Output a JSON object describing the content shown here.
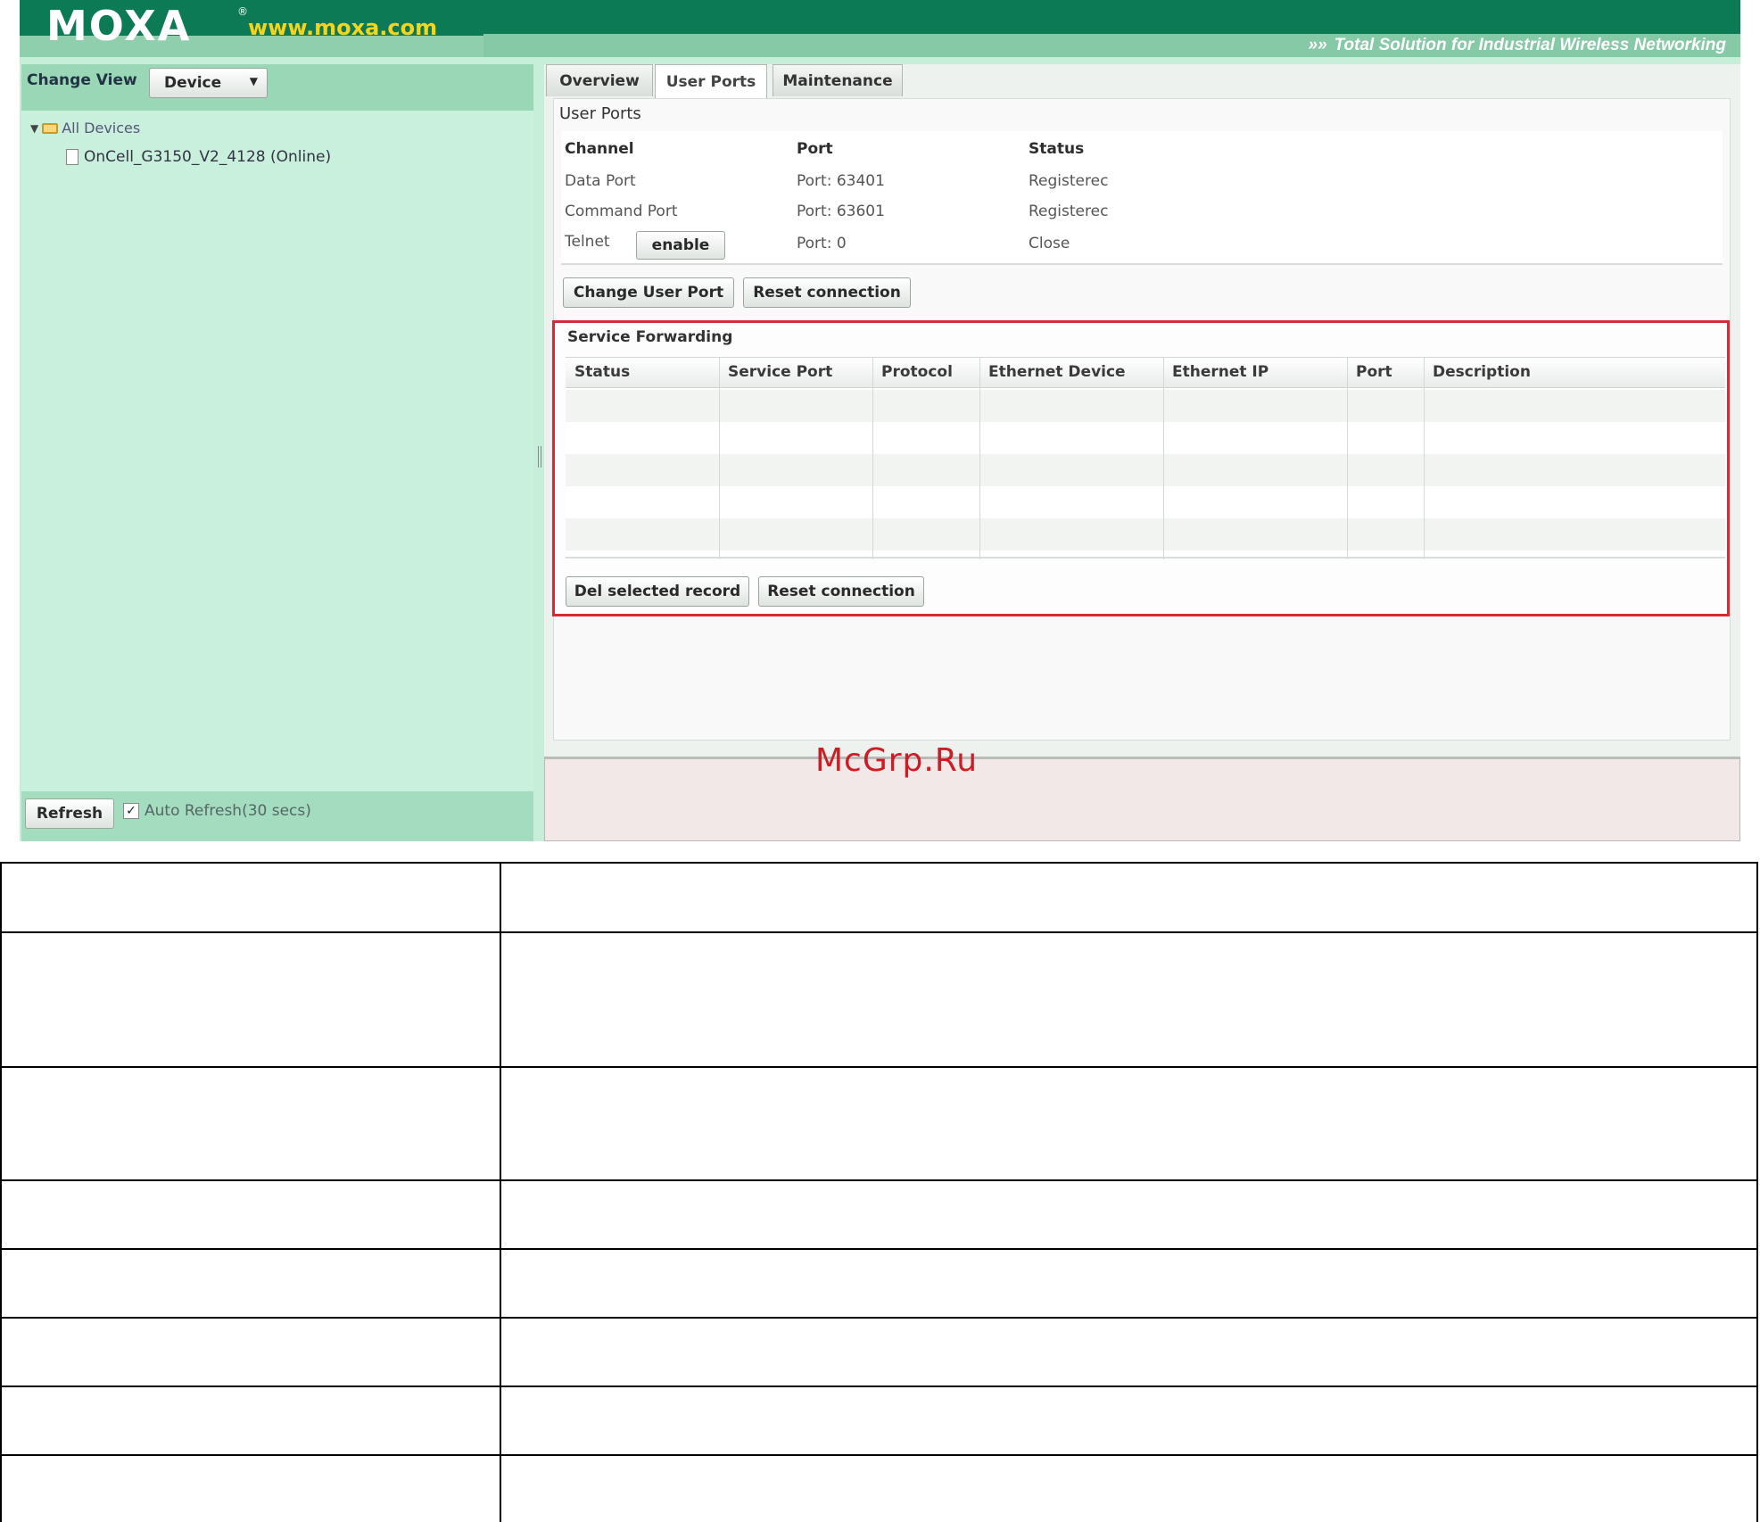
{
  "header": {
    "logo": "MOXA",
    "logo_mark": "®",
    "website": "www.moxa.com",
    "tagline_arrows": "»»",
    "tagline": "Total Solution for Industrial Wireless Networking",
    "colors": {
      "band": "#0d7a56",
      "url": "#f7d31a"
    }
  },
  "left_panel": {
    "change_view_label": "Change View",
    "view_select": "Device",
    "tree": {
      "root_label": "All Devices",
      "child_label": "OnCell_G3150_V2_4128 (Online)"
    },
    "refresh_button": "Refresh",
    "auto_refresh": {
      "checked": true,
      "check_glyph": "✓",
      "label": "Auto Refresh(30 secs)"
    }
  },
  "tabs": [
    {
      "label": "Overview",
      "active": false
    },
    {
      "label": "User Ports",
      "active": true
    },
    {
      "label": "Maintenance",
      "active": false
    }
  ],
  "user_ports": {
    "section_title": "User Ports",
    "columns": [
      "Channel",
      "Port",
      "Status"
    ],
    "rows": [
      {
        "channel": "Data Port",
        "port": "Port: 63401",
        "status": "Registerec"
      },
      {
        "channel": "Command Port",
        "port": "Port: 63601",
        "status": "Registerec"
      },
      {
        "channel": "Telnet",
        "port": "Port: 0",
        "status": "Close",
        "button": "enable"
      }
    ],
    "buttons": {
      "change_user_port": "Change User Port",
      "reset_connection": "Reset connection"
    }
  },
  "service_forwarding": {
    "title": "Service Forwarding",
    "columns": [
      "Status",
      "Service Port",
      "Protocol",
      "Ethernet Device",
      "Ethernet IP",
      "Port",
      "Description"
    ],
    "rows": [],
    "buttons": {
      "del_selected_record": "Del selected record",
      "reset_connection": "Reset connection"
    },
    "highlight_color": "#d72a36"
  },
  "watermark": "McGrp.Ru",
  "doc_table": {
    "rows": [
      [
        "",
        ""
      ],
      [
        "",
        ""
      ],
      [
        "",
        ""
      ],
      [
        "",
        ""
      ],
      [
        "",
        ""
      ],
      [
        "",
        ""
      ],
      [
        "",
        ""
      ],
      [
        "",
        ""
      ]
    ]
  }
}
